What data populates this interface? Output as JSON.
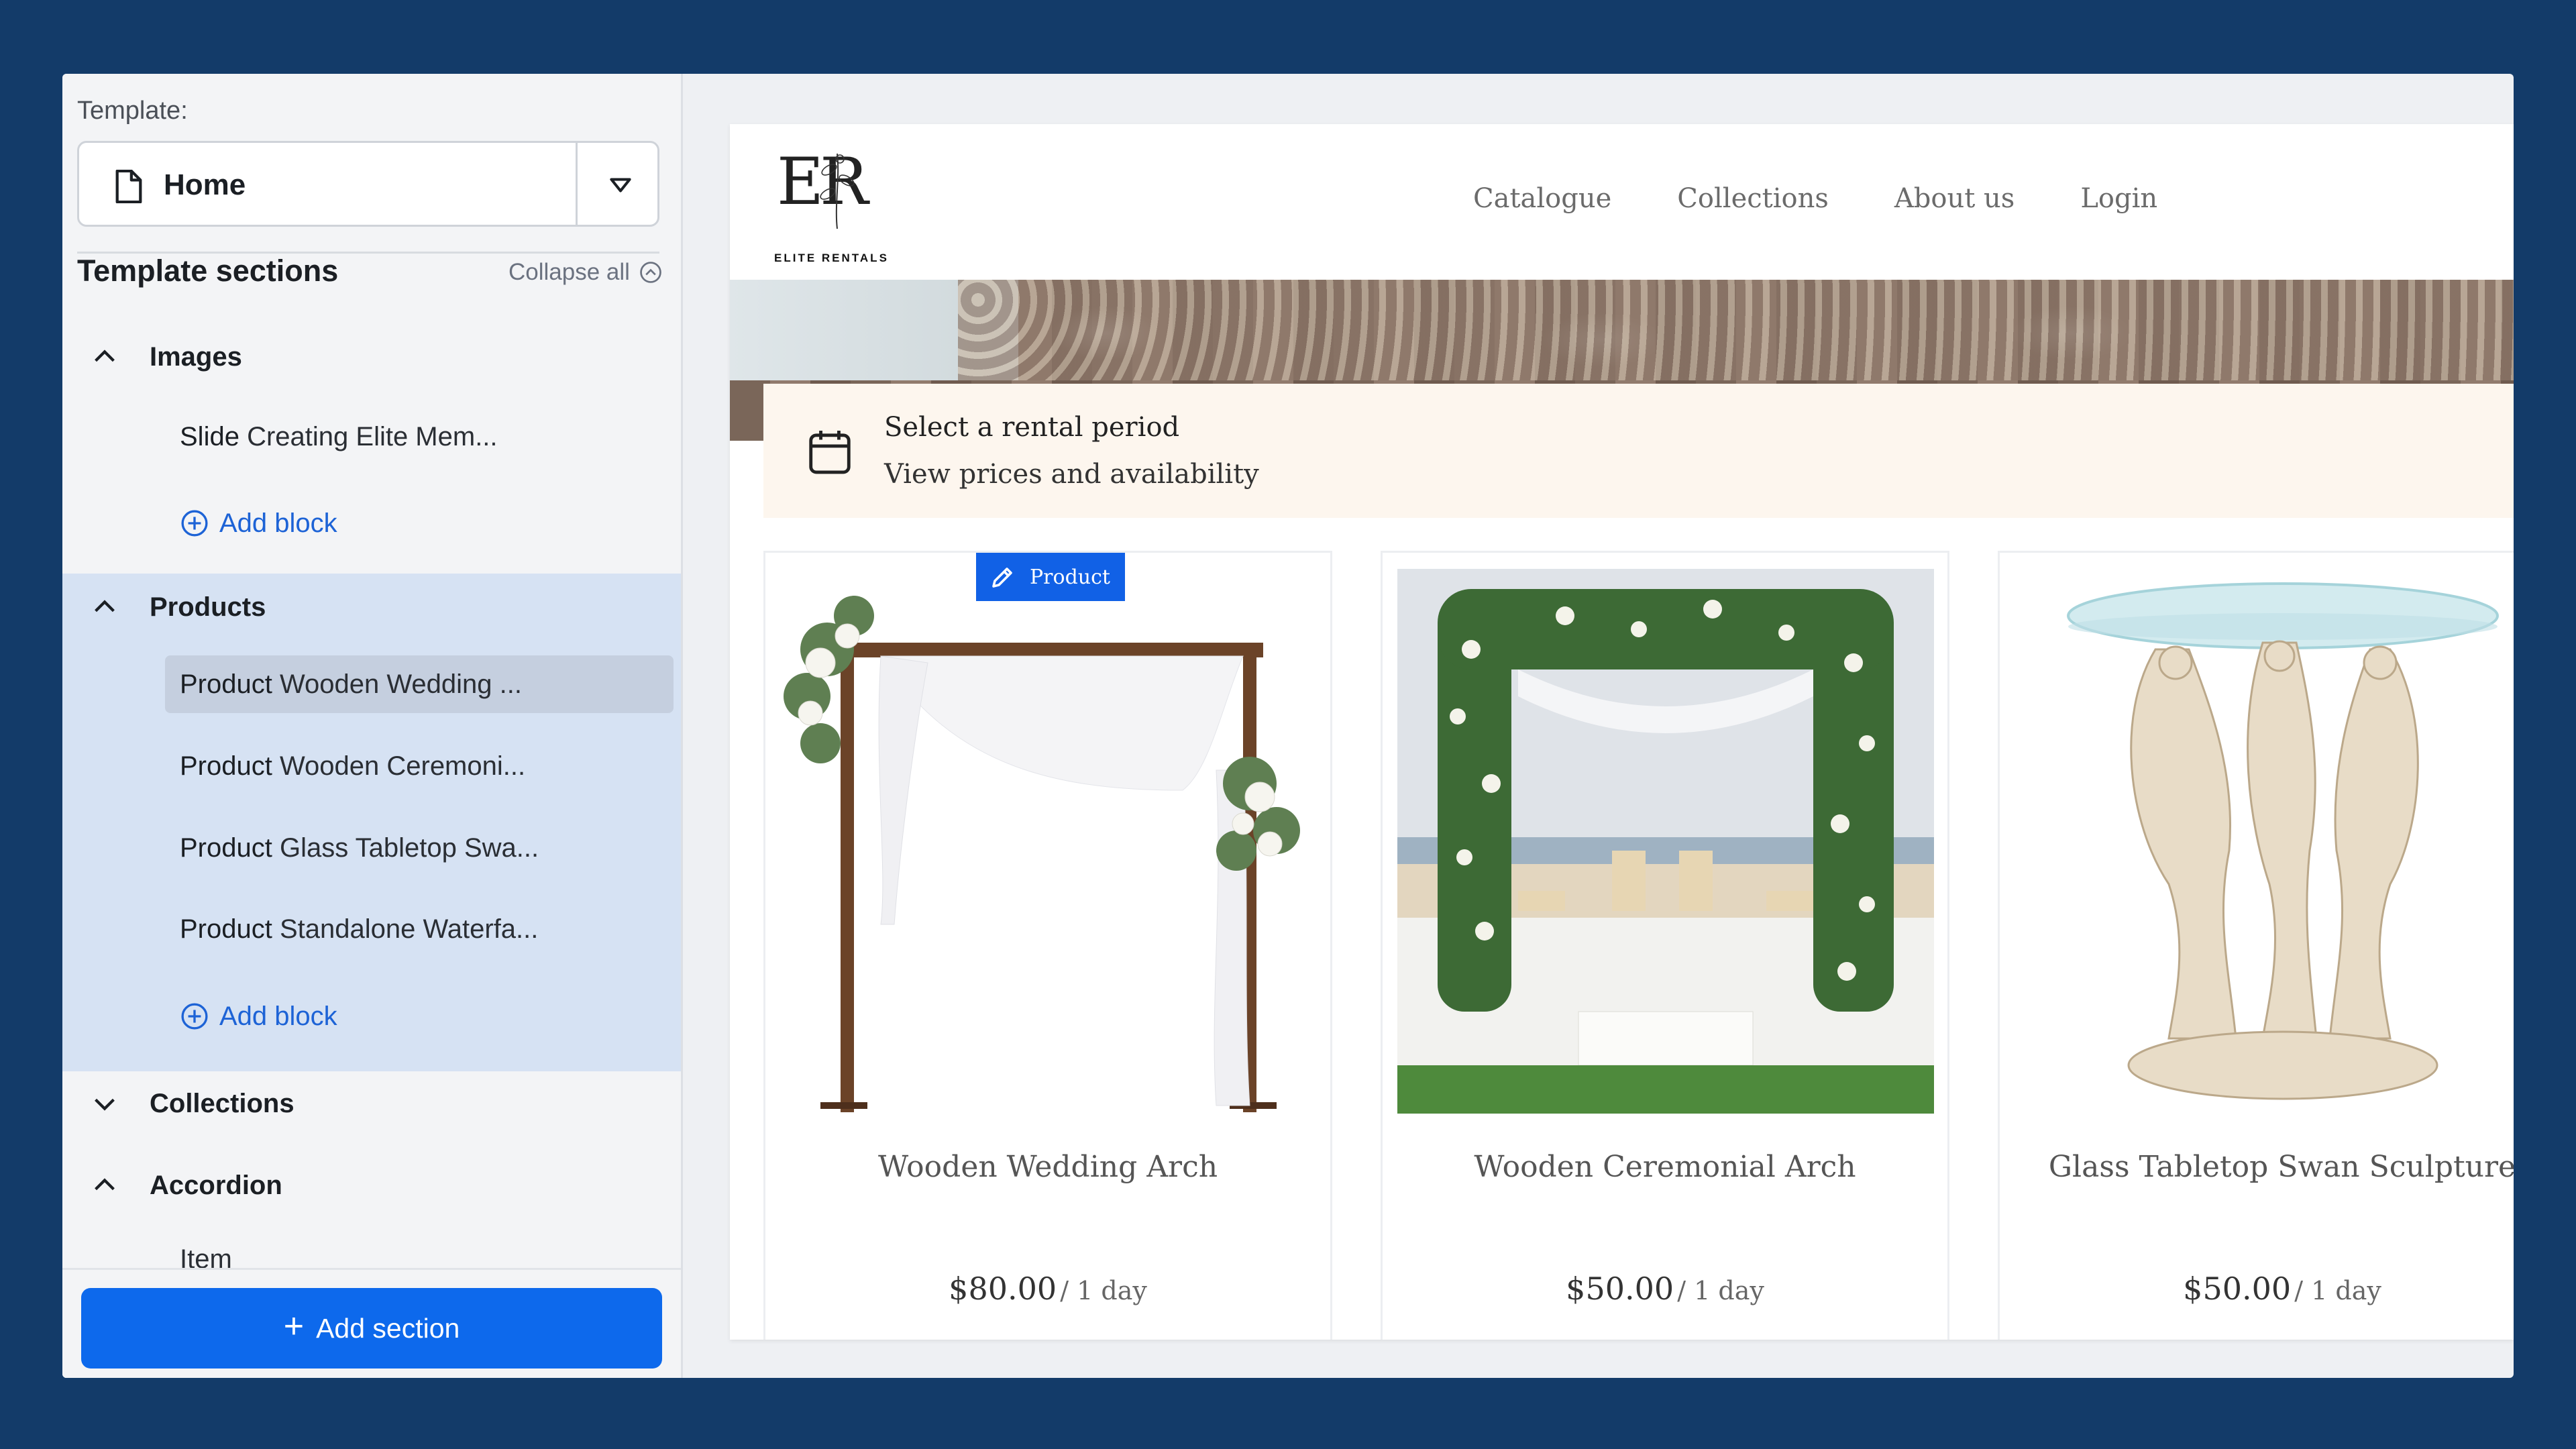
{
  "editor": {
    "template_label": "Template:",
    "template_value": "Home",
    "sections_title": "Template sections",
    "collapse_all": "Collapse all",
    "groups": [
      {
        "label": "Images",
        "items": [
          {
            "kind": "Slide",
            "name": "Creating Elite Mem..."
          }
        ],
        "add_block": "Add block"
      },
      {
        "label": "Products",
        "items": [
          {
            "kind": "Product",
            "name": "Wooden Wedding ..."
          },
          {
            "kind": "Product",
            "name": "Wooden Ceremoni..."
          },
          {
            "kind": "Product",
            "name": "Glass Tabletop Swa..."
          },
          {
            "kind": "Product",
            "name": "Standalone Waterfa..."
          }
        ],
        "add_block": "Add block"
      },
      {
        "label": "Collections"
      },
      {
        "label": "Accordion",
        "items": [
          {
            "kind": "Item",
            "name": ""
          }
        ]
      }
    ],
    "add_section": "Add section"
  },
  "site": {
    "logo_letters": "ER",
    "logo_text": "ELITE RENTALS",
    "nav": [
      "Catalogue",
      "Collections",
      "About us",
      "Login"
    ],
    "rental_title": "Select a rental period",
    "rental_subtitle": "View prices and availability",
    "product_tag": "Product",
    "products": [
      {
        "title": "Wooden Wedding Arch",
        "price": "$80.00",
        "per": "/ 1 day"
      },
      {
        "title": "Wooden Ceremonial Arch",
        "price": "$50.00",
        "per": "/ 1 day"
      },
      {
        "title": "Glass Tabletop Swan Sculpture",
        "price": "$50.00",
        "per": "/ 1 day"
      }
    ]
  },
  "colors": {
    "accent": "#0d69ec",
    "frame": "#133b69",
    "selected_group": "#d6e2f3",
    "rental_bar": "#fdf6ee"
  }
}
